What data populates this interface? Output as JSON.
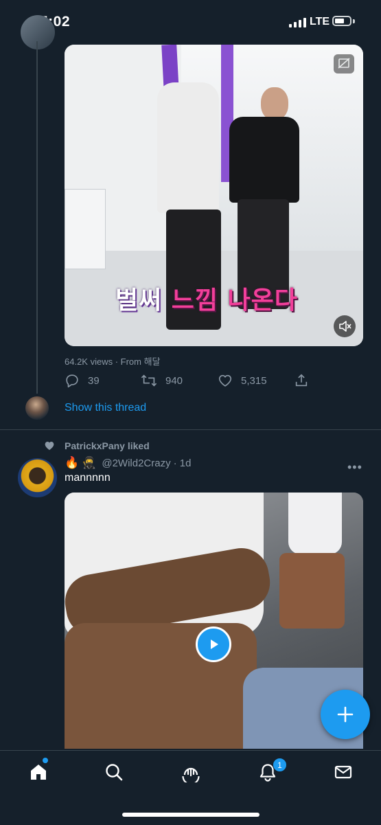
{
  "status_bar": {
    "time": "5:02",
    "network": "LTE"
  },
  "tweet1": {
    "media_caption_part1": "벌써 ",
    "media_caption_part2": "느낌 ",
    "media_caption_part3": "나온다",
    "views_text": "64.2K views · From 해달",
    "replies": "39",
    "retweets": "940",
    "likes": "5,315",
    "show_thread": "Show this thread"
  },
  "tweet2": {
    "liked_by": "PatrickxPany liked",
    "emoji_fire": "🔥",
    "emoji_face": "🥷",
    "handle": "@2Wild2Crazy",
    "time": "· 1d",
    "text": "mannnnn",
    "more": "•••"
  },
  "nav": {
    "notifications_badge": "1"
  },
  "colors": {
    "background": "#15202b",
    "accent": "#1d9bf0",
    "muted": "#8b98a5",
    "divider": "#38444d"
  }
}
